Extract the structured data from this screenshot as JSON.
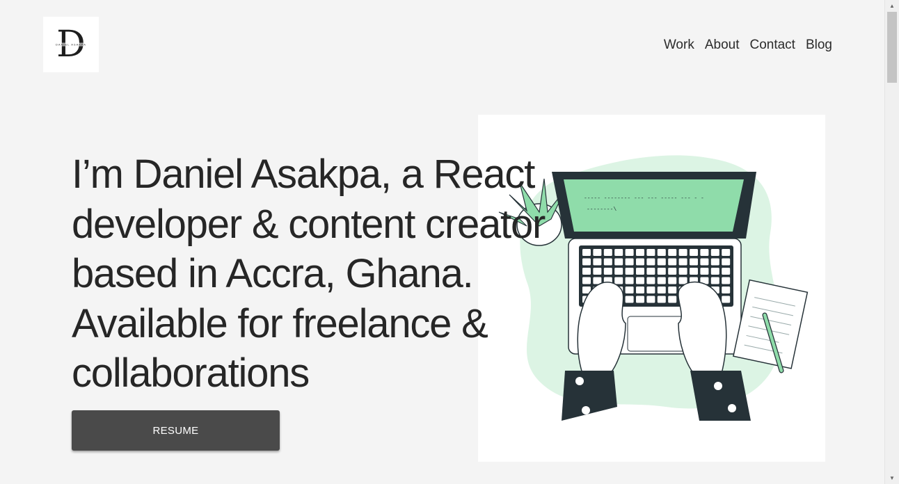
{
  "header": {
    "logo_letter": "D",
    "logo_subtext": "DANIEL ASAKPA",
    "nav": [
      "Work",
      "About",
      "Contact",
      "Blog"
    ]
  },
  "hero": {
    "title": "I’m Daniel Asakpa, a React developer & content creator based in Accra, Ghana. Available for freelance & collaborations",
    "resume_label": "RESUME"
  },
  "illustration": {
    "screen_line_1": "----- -------- --- ---     ----- --- - -",
    "screen_line_2": "--------\\",
    "accent_color": "#8fdcaa",
    "blob_color": "#dcf4e4",
    "dark_color": "#263238"
  }
}
